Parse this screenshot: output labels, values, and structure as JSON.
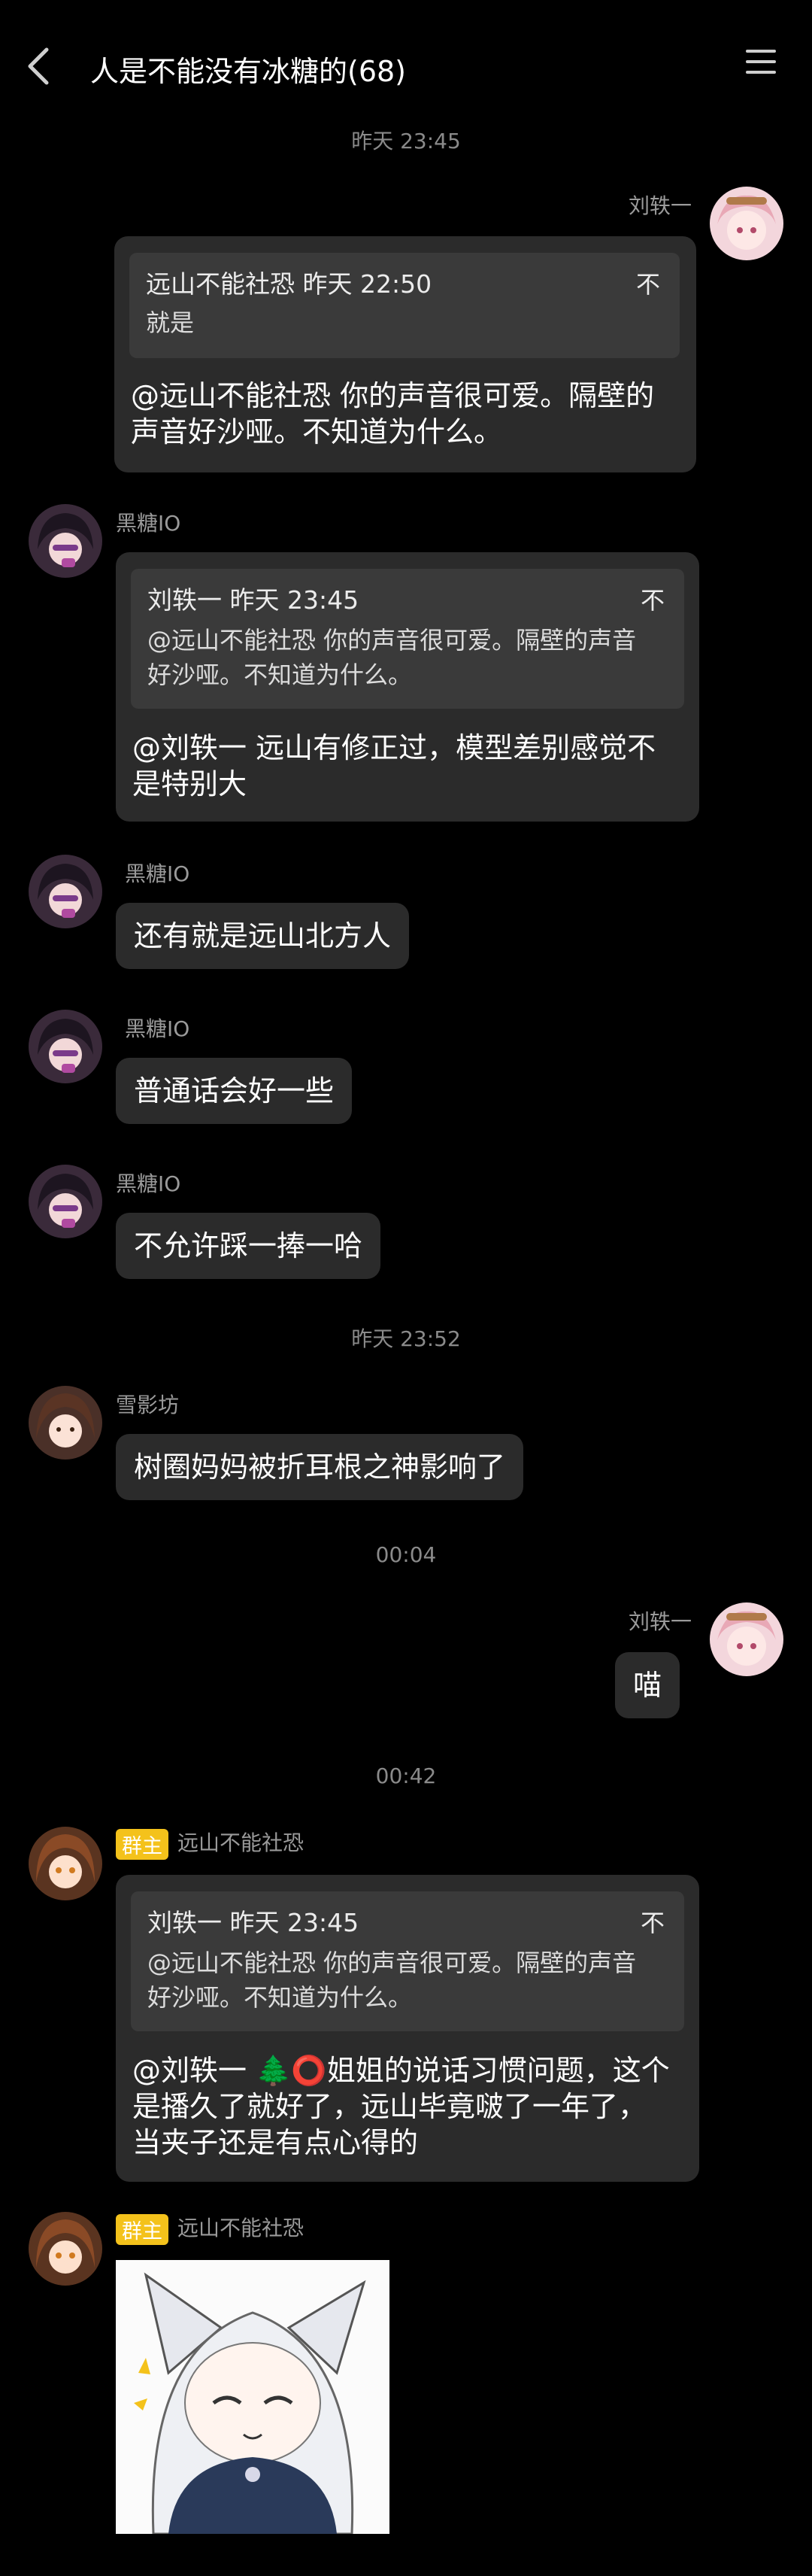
{
  "header": {
    "title": "人是不能没有冰糖的(68)"
  },
  "messages": {
    "ts1": "昨天 23:45",
    "m1": {
      "sender": "刘轶一",
      "quote_head": "远山不能社恐 昨天 22:50",
      "quote_body": "就是",
      "text": "@远山不能社恐 你的声音很可爱。隔壁的声音好沙哑。不知道为什么。"
    },
    "m2": {
      "sender": "黑糖IO",
      "quote_head": "刘轶一 昨天 23:45",
      "quote_body": "@远山不能社恐 你的声音很可爱。隔壁的声音好沙哑。不知道为什么。",
      "text": "@刘轶一 远山有修正过，模型差别感觉不是特别大"
    },
    "m3": {
      "sender": "黑糖IO",
      "text": "还有就是远山北方人"
    },
    "m4": {
      "sender": "黑糖IO",
      "text": "普通话会好一些"
    },
    "m5": {
      "sender": "黑糖IO",
      "text": "不允许踩一捧一哈"
    },
    "ts2": "昨天 23:52",
    "m6": {
      "sender": "雪影坊",
      "text": "树圈妈妈被折耳根之神影响了"
    },
    "ts3": "00:04",
    "m7": {
      "sender": "刘轶一",
      "text": "喵"
    },
    "ts4": "00:42",
    "m8": {
      "badge": "群主",
      "sender": "远山不能社恐",
      "quote_head": "刘轶一 昨天 23:45",
      "quote_body": "@远山不能社恐 你的声音很可爱。隔壁的声音好沙哑。不知道为什么。",
      "text": "@刘轶一 🌲⭕姐姐的说话习惯问题，这个是播久了就好了，远山毕竟啵了一年了，当夹子还是有点心得的"
    },
    "m9": {
      "badge": "群主",
      "sender": "远山不能社恐"
    }
  },
  "pin_icon": "不",
  "colors": {
    "background": "#000000",
    "bubble": "#2b2b2b",
    "quote": "#3a3a3a",
    "badge": "#f4c21b"
  }
}
